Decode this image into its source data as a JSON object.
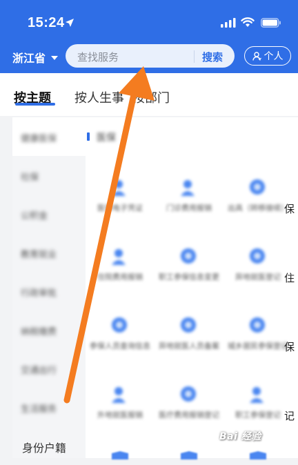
{
  "status_bar": {
    "time": "15:24"
  },
  "nav": {
    "province": "浙江省",
    "search_placeholder": "查找服务",
    "search_button": "搜索",
    "personal_button": "个人"
  },
  "tabs": [
    {
      "label": "按主题",
      "active": true
    },
    {
      "label": "按人生事",
      "active": false
    },
    {
      "label": "按部门",
      "active": false
    }
  ],
  "sidebar": {
    "items": [
      {
        "label": "健康医保",
        "active": true
      },
      {
        "label": "社保",
        "active": false
      },
      {
        "label": "公积金",
        "active": false
      },
      {
        "label": "教育就业",
        "active": false
      },
      {
        "label": "行政审批",
        "active": false
      },
      {
        "label": "纳税缴费",
        "active": false
      },
      {
        "label": "交通出行",
        "active": false
      },
      {
        "label": "生活服务",
        "active": false
      },
      {
        "label": "身份户籍",
        "active": false
      }
    ]
  },
  "breadcrumb": {
    "label": "医保"
  },
  "services": [
    {
      "label": "医保电子凭证",
      "tail": ""
    },
    {
      "label": "门诊费用报销",
      "tail": ""
    },
    {
      "label": "出具（转移接续）",
      "tail": "保"
    },
    {
      "label": "住院费用报销",
      "tail": ""
    },
    {
      "label": "职工参保信息变更",
      "tail": ""
    },
    {
      "label": "异地就医登记",
      "tail": "住"
    },
    {
      "label": "参保人员查询信息",
      "tail": ""
    },
    {
      "label": "异地就医人员备案",
      "tail": ""
    },
    {
      "label": "城乡居民参保登记",
      "tail": "保"
    },
    {
      "label": "外地就医报销",
      "tail": ""
    },
    {
      "label": "医疗费用报销登记",
      "tail": ""
    },
    {
      "label": "职工参保登记",
      "tail": "记"
    }
  ],
  "watermark": "Bai 经验",
  "colors": {
    "primary": "#2f6ee6",
    "arrow": "#f47c20"
  }
}
